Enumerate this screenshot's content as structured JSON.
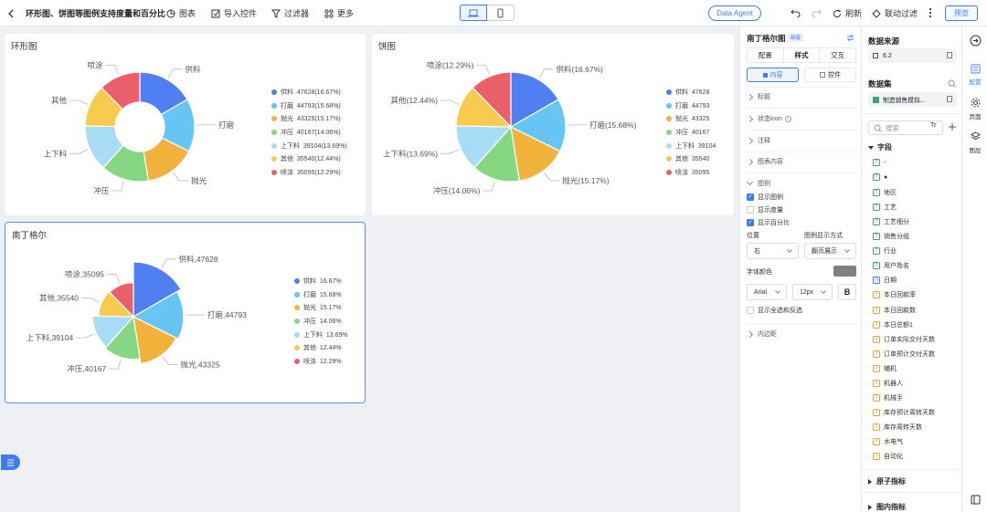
{
  "topbar": {
    "title": "环形图、饼图等图例支持度量和百分比",
    "chart_btn": "图表",
    "import_btn": "导入控件",
    "filter_btn": "过滤器",
    "more_btn": "更多",
    "data_agent": "Data Agent",
    "refresh": "刷新",
    "linkage": "联动过滤",
    "preview": "预览"
  },
  "cards": {
    "donut": {
      "title": "环形图"
    },
    "pie": {
      "title": "饼图"
    },
    "rose": {
      "title": "南丁格尔"
    }
  },
  "chart_data": [
    {
      "type": "pie",
      "variant": "donut",
      "title": "环形图",
      "categories": [
        "供料",
        "打磨",
        "抛光",
        "冲压",
        "上下料",
        "其他",
        "喷涂"
      ],
      "values": [
        47628,
        44793,
        43325,
        40167,
        39104,
        35540,
        35095
      ],
      "percents": [
        "16.67%",
        "15.68%",
        "15.17%",
        "14.06%",
        "13.69%",
        "12.44%",
        "12.29%"
      ],
      "slice_labels": [
        "供料",
        "打磨",
        "抛光",
        "冲压",
        "上下料",
        "其他",
        "喷涂"
      ],
      "legend": [
        "供料  47628(16.67%)",
        "打磨  44793(15.68%)",
        "抛光  43325(15.17%)",
        "冲压  40167(14.06%)",
        "上下料  39104(13.69%)",
        "其他  35540(12.44%)",
        "喷涂  35095(12.29%)"
      ],
      "legend_position": "right",
      "colors": [
        "#4f7ff1",
        "#66c5f2",
        "#f2b33d",
        "#85d782",
        "#a8dcf6",
        "#f7cb4d",
        "#e9606a"
      ]
    },
    {
      "type": "pie",
      "title": "饼图",
      "categories": [
        "供料",
        "打磨",
        "抛光",
        "冲压",
        "上下料",
        "其他",
        "喷涂"
      ],
      "values": [
        47628,
        44793,
        43325,
        40167,
        39104,
        35540,
        35095
      ],
      "slice_labels": [
        "供料(16.67%)",
        "打磨(15.68%)",
        "抛光(15.17%)",
        "冲压(14.06%)",
        "上下料(13.69%)",
        "其他(12.44%)",
        "喷涂(12.29%)"
      ],
      "legend": [
        "供料  47628",
        "打磨  44793",
        "抛光  43325",
        "冲压  40167",
        "上下料  39104",
        "其他  35540",
        "喷涂  35095"
      ],
      "legend_position": "right",
      "colors": [
        "#4f7ff1",
        "#66c5f2",
        "#f2b33d",
        "#85d782",
        "#a8dcf6",
        "#f7cb4d",
        "#e9606a"
      ]
    },
    {
      "type": "pie",
      "variant": "rose",
      "title": "南丁格尔",
      "categories": [
        "供料",
        "打磨",
        "抛光",
        "冲压",
        "上下料",
        "其他",
        "喷涂"
      ],
      "values": [
        47628,
        44793,
        43325,
        40167,
        39104,
        35540,
        35095
      ],
      "slice_labels": [
        "供料,47628",
        "打磨,44793",
        "抛光,43325",
        "冲压,40167",
        "上下料,39104",
        "其他,35540",
        "喷涂,35095"
      ],
      "legend": [
        "供料  16.67%",
        "打磨  15.68%",
        "抛光  15.17%",
        "冲压  14.06%",
        "上下料  13.69%",
        "其他  12.44%",
        "喷涂  12.29%"
      ],
      "legend_position": "right",
      "colors": [
        "#4f7ff1",
        "#66c5f2",
        "#f2b33d",
        "#85d782",
        "#a8dcf6",
        "#f7cb4d",
        "#e9606a"
      ]
    }
  ],
  "config": {
    "chart_name": "南丁格尔图",
    "badge": "新版",
    "tabs": [
      "配置",
      "样式",
      "交互"
    ],
    "subtabs": [
      "内容",
      "控件"
    ],
    "sections": [
      "标题",
      "状态icon",
      "注释",
      "图表内容",
      "图例",
      "内边距"
    ],
    "legend_opts": {
      "show_legend": "显示图例",
      "show_measure": "显示度量",
      "show_percent": "显示百分比",
      "position_label": "位置",
      "mode_label": "图例显示方式",
      "position_value": "右",
      "mode_value": "翻页展示",
      "font_color_label": "字体颜色",
      "font_value": "Arial",
      "size_value": "12px",
      "bold": "B",
      "show_all": "显示全选和反选"
    }
  },
  "data_panel": {
    "source_title": "数据来源",
    "source_value": "6.2",
    "dataset_title": "数据集",
    "dataset_value": "制造销售模拟...",
    "search_placeholder": "搜索",
    "fields_title": "字段",
    "fields": [
      "-",
      "●",
      "地区",
      "工艺",
      "工艺细分",
      "销售分组",
      "行业",
      "用户姓名",
      "日期",
      "本日回款率",
      "本日回款数",
      "本日总额1",
      "订单实际交付天数",
      "订单预计交付天数",
      "辅机",
      "机器人",
      "机械手",
      "库存预计周转天数",
      "库存周转天数",
      "水电气",
      "自动化"
    ],
    "field_types": [
      "t",
      "t",
      "t",
      "t",
      "t",
      "t",
      "t",
      "t",
      "c",
      "n",
      "n",
      "n",
      "n",
      "n",
      "n",
      "n",
      "n",
      "n",
      "n",
      "n",
      "n"
    ],
    "atomic": "原子指标",
    "inner": "图内指标"
  },
  "rail": {
    "config": "配置",
    "page": "页面",
    "layer": "图层"
  }
}
